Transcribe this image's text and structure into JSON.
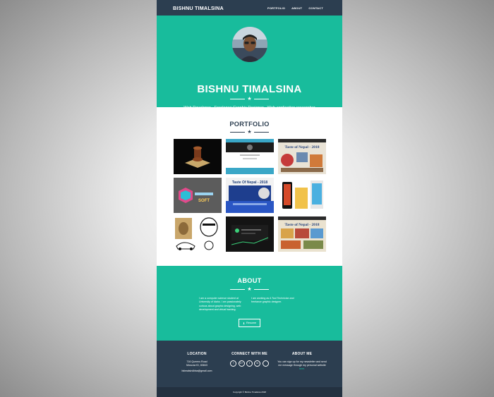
{
  "nav": {
    "brand": "BISHNU TIMALSINA",
    "items": [
      "PORTFOLIO",
      "ABOUT",
      "CONTACT"
    ]
  },
  "hero": {
    "name": "BISHNU TIMALSINA",
    "subtitle": "Web Developer - Freelance Graphic Designer - Web application researcher"
  },
  "portfolio": {
    "title": "PORTFOLIO",
    "tiles": [
      {
        "label": ""
      },
      {
        "label": ""
      },
      {
        "label": "Taste of Nepal - 2018"
      },
      {
        "label": "SOFT"
      },
      {
        "label": "Taste Of Nepal - 2018"
      },
      {
        "label": ""
      },
      {
        "label": ""
      },
      {
        "label": ""
      },
      {
        "label": "Taste of Nepal - 2018"
      }
    ]
  },
  "about": {
    "title": "ABOUT",
    "left_text": "I am a computer science student at University of Idaho. I am passionately curious about graphic designing, web development and virtual hacking.",
    "right_text": "I am working as A Tool Technician and freelance graphic designer.",
    "resume_label": "Resume"
  },
  "footer": {
    "location_title": "LOCATION",
    "location_line1": "716 Queens Road",
    "location_line2": "Moscow ID, 83843",
    "location_email": "bkimalsin4bba@gmail.com",
    "connect_title": "CONNECT WITH ME",
    "social": [
      "f",
      "G+",
      "t",
      "in",
      ""
    ],
    "aboutme_title": "ABOUT ME",
    "aboutme_text": "You can sign up for my newsletter and send me message through my personal website",
    "aboutme_link": "here.",
    "copyright": "Copyright © Bishnu Timalsina 2018"
  },
  "colors": {
    "primary": "#2c3e50",
    "accent": "#18bc9c"
  }
}
